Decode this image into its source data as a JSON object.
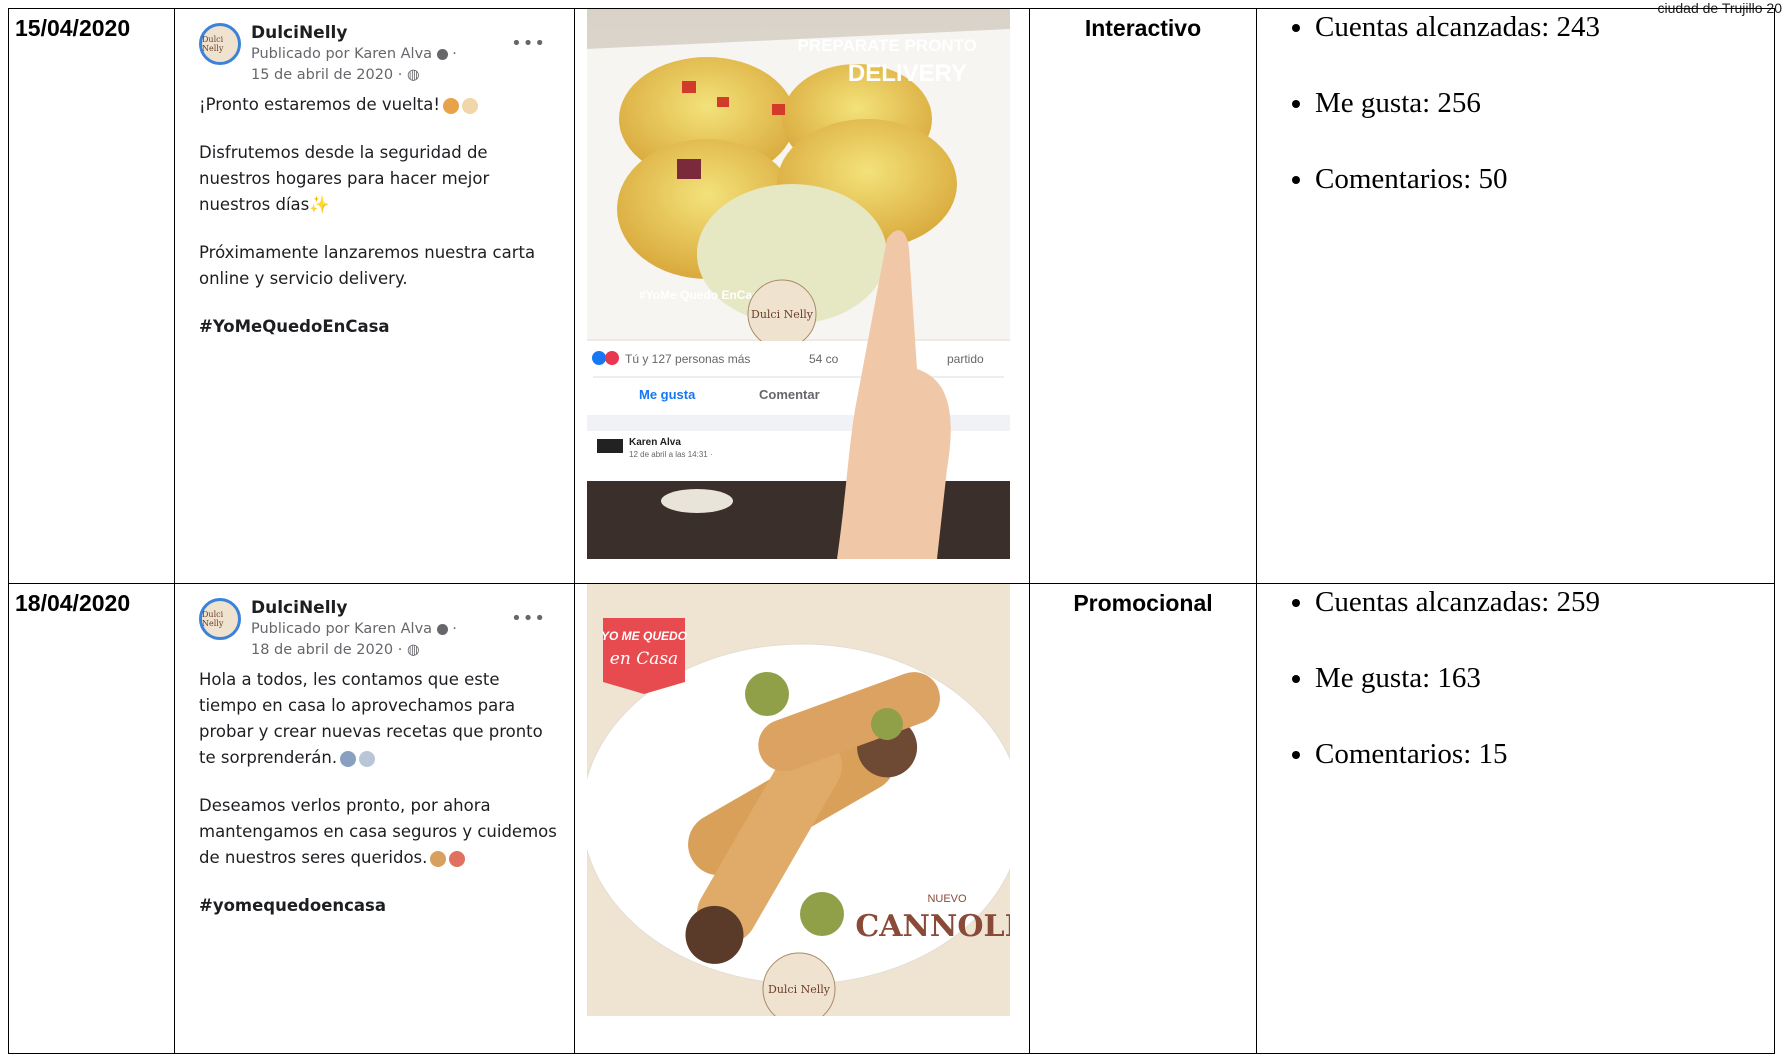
{
  "header_fragment": "ciudad de Trujillo 20",
  "rows": [
    {
      "date": "15/04/2020",
      "post": {
        "page_name": "DulciNelly",
        "published_by": "Publicado por Karen Alva",
        "date_line": "15 de abril de 2020 ·",
        "avatar_text": "Dulci Nelly",
        "paragraphs": [
          "¡Pronto estaremos de vuelta!",
          "Disfrutemos desde la seguridad de nuestros hogares para hacer mejor nuestros días",
          "Próximamente lanzaremos nuestra carta online y servicio delivery."
        ],
        "hashtag": "#YoMeQuedoEnCasa"
      },
      "image": {
        "headline_1": "PREPARATE PRONTO",
        "headline_2": "DELIVERY",
        "stamp": "#YoMe Quedo EnCasa",
        "logo": "Dulci Nelly",
        "reactions": "Tú y 127 personas más",
        "comments": "54 co",
        "shared": "partido",
        "like_btn": "Me gusta",
        "comment_btn": "Comentar",
        "commenter": "Karen Alva",
        "comment_date": "12 de abril a las 14:31 ·"
      },
      "type": "Interactivo",
      "metrics": [
        "Cuentas alcanzadas: 243",
        "Me gusta: 256",
        "Comentarios: 50"
      ]
    },
    {
      "date": "18/04/2020",
      "post": {
        "page_name": "DulciNelly",
        "published_by": "Publicado por Karen Alva",
        "date_line": "18 de abril de 2020 ·",
        "avatar_text": "Dulci Nelly",
        "paragraphs": [
          "Hola a todos, les contamos que este tiempo en casa lo aprovechamos para probar y crear nuevas recetas que pronto te sorprenderán.",
          "Deseamos verlos pronto, por ahora mantengamos en casa seguros y cuidemos de nuestros seres queridos."
        ],
        "hashtag": "#yomequedoencasa"
      },
      "image": {
        "tag_1": "YO ME QUEDO",
        "tag_2": "en Casa",
        "nuevo": "NUEVO",
        "product": "CANNOLI",
        "logo": "Dulci Nelly"
      },
      "type": "Promocional",
      "metrics": [
        "Cuentas alcanzadas: 259",
        "Me gusta: 163",
        "Comentarios: 15"
      ]
    }
  ],
  "colors": {
    "fb_blue": "#1877f2",
    "border": "#000000",
    "cream": "#efe2cf",
    "badge_red": "#e84b4f"
  }
}
